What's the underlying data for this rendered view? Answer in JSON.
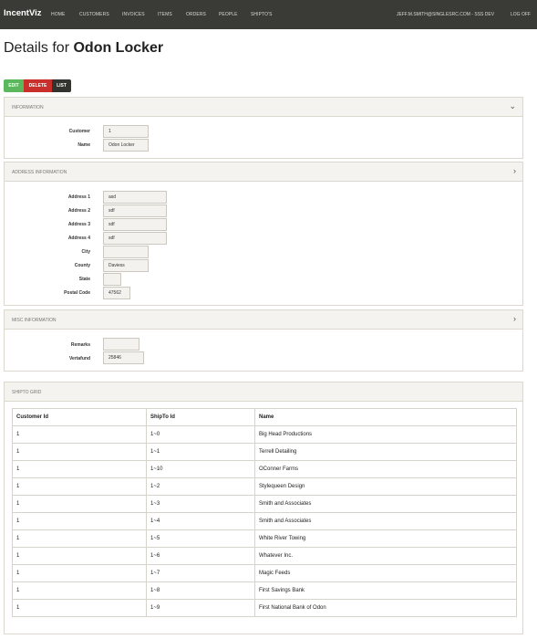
{
  "nav": {
    "brand": "IncentViz",
    "items": [
      "HOME",
      "CUSTOMERS",
      "INVOICES",
      "ITEMS",
      "ORDERS",
      "PEOPLE",
      "SHIPTO'S"
    ],
    "user": "JEFF.M.SMITH@SINGLESRC.COM - SSS DEV",
    "logoff": "LOG OFF"
  },
  "page": {
    "title_prefix": "Details for ",
    "title_name": "Odon Locker"
  },
  "actions": {
    "edit": "EDIT",
    "delete": "DELETE",
    "list": "LIST"
  },
  "information": {
    "title": "INFORMATION",
    "customer_label": "Customer",
    "customer_value": "1",
    "name_label": "Name",
    "name_value": "Odon Locker"
  },
  "address": {
    "title": "ADDRESS INFORMATION",
    "address1_label": "Address 1",
    "address1_value": "asd",
    "address2_label": "Address 2",
    "address2_value": "sdf",
    "address3_label": "Address 3",
    "address3_value": "sdf",
    "address4_label": "Address 4",
    "address4_value": "sdf",
    "city_label": "City",
    "city_value": "",
    "county_label": "County",
    "county_value": "Daviess",
    "state_label": "State",
    "state_value": "",
    "postal_label": "Postal Code",
    "postal_value": "47562"
  },
  "misc": {
    "title": "MISC INFORMATION",
    "remarks_label": "Remarks",
    "remarks_value": "",
    "vertafund_label": "Vertafund",
    "vertafund_value": "25846"
  },
  "shipto": {
    "title": "SHIPTO GRID",
    "columns": [
      "Customer Id",
      "ShipTo Id",
      "Name"
    ],
    "rows": [
      [
        "1",
        "1~0",
        "Big Head Productions"
      ],
      [
        "1",
        "1~1",
        "Terrell Detailing"
      ],
      [
        "1",
        "1~10",
        "OConner Farms"
      ],
      [
        "1",
        "1~2",
        "Stylequeen Design"
      ],
      [
        "1",
        "1~3",
        "Smith and Associates"
      ],
      [
        "1",
        "1~4",
        "Smith and Associates"
      ],
      [
        "1",
        "1~5",
        "White River Towing"
      ],
      [
        "1",
        "1~6",
        "Whatever Inc."
      ],
      [
        "1",
        "1~7",
        "Magic Feeds"
      ],
      [
        "1",
        "1~8",
        "First Savings Bank"
      ],
      [
        "1",
        "1~9",
        "First National Bank of Odon"
      ]
    ]
  },
  "icons": {
    "collapse": "chevron-down-icon",
    "expand": "chevron-right-icon"
  }
}
